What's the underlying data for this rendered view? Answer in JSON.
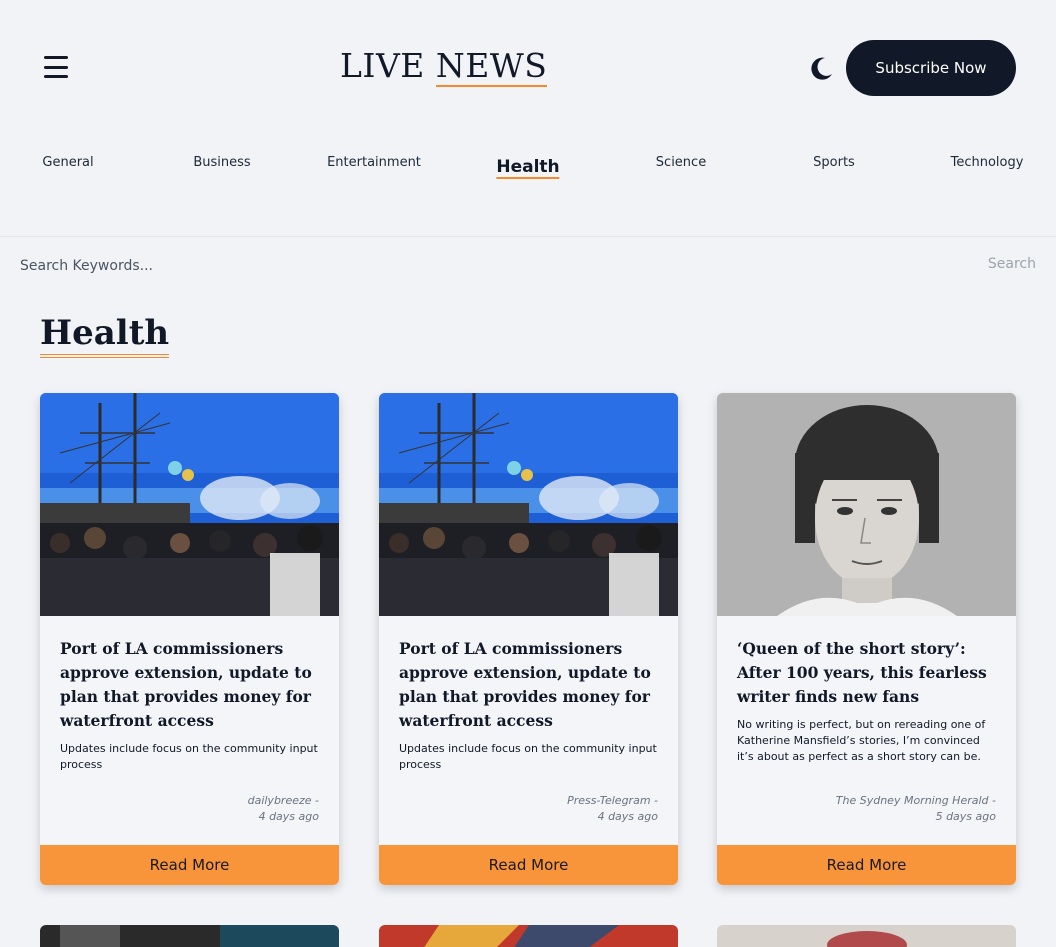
{
  "header": {
    "logo_part1": "LIVE",
    "logo_part2": "NEWS",
    "subscribe_label": "Subscribe Now",
    "menu_icon": "hamburger-icon",
    "theme_icon": "moon-icon"
  },
  "categories": [
    "General",
    "Business",
    "Entertainment",
    "Health",
    "Science",
    "Sports",
    "Technology"
  ],
  "active_category": "Health",
  "search": {
    "placeholder": "Search Keywords...",
    "button_label": "Search"
  },
  "section_title": "Health",
  "colors": {
    "accent": "#f28b30",
    "button": "#f8953b",
    "dark": "#111827",
    "background": "#f1f3f7"
  },
  "articles": [
    {
      "title": "Port of LA commissioners approve extension, update to plan that provides money for waterfront access",
      "description": "Updates include focus on the community input process",
      "source": "dailybreeze -",
      "time": "4 days ago",
      "read_more": "Read More"
    },
    {
      "title": "Port of LA commissioners approve extension, update to plan that provides money for waterfront access",
      "description": "Updates include focus on the community input process",
      "source": "Press-Telegram -",
      "time": "4 days ago",
      "read_more": "Read More"
    },
    {
      "title": "‘Queen of the short story’: After 100 years, this fearless writer finds new fans",
      "description": "No writing is perfect, but on rereading one of Katherine Mansfield’s stories, I’m convinced it’s about as perfect as a short story can be.",
      "source": "The Sydney Morning Herald -",
      "time": "5 days ago",
      "read_more": "Read More"
    }
  ]
}
